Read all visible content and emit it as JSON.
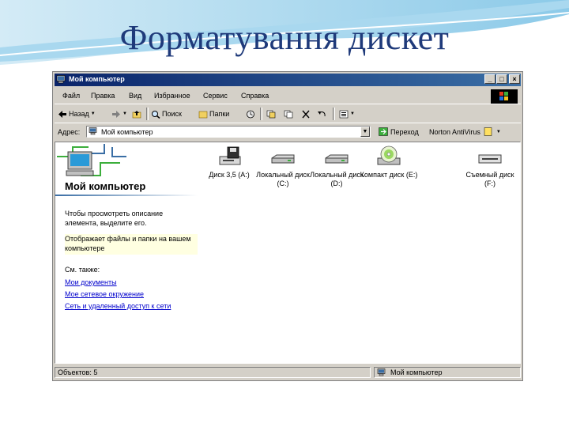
{
  "slide": {
    "title": "Форматування дискет"
  },
  "window": {
    "title": "Мой компьютер",
    "controls": {
      "minimize": "_",
      "maximize": "□",
      "close": "×"
    }
  },
  "menu": [
    "Файл",
    "Правка",
    "Вид",
    "Избранное",
    "Сервис",
    "Справка"
  ],
  "toolbar": {
    "back_label": "Назад",
    "search_label": "Поиск",
    "folders_label": "Папки"
  },
  "address": {
    "label": "Адрес:",
    "value": "Мой компьютер",
    "go_label": "Переход",
    "norton_label": "Norton AntiVirus"
  },
  "left_pane": {
    "heading": "Мой компьютер",
    "description": "Чтобы просмотреть описание элемента, выделите его.",
    "info": "Отображает файлы и папки на вашем компьютере",
    "see_also": "См. также:",
    "links": [
      "Мои документы",
      "Мое сетевое окружение",
      "Сеть и удаленный доступ к сети"
    ]
  },
  "drives": [
    {
      "label": "Диск 3,5 (A:)",
      "icon": "floppy-drive-icon"
    },
    {
      "label": "Локальный диск (C:)",
      "icon": "hard-drive-icon"
    },
    {
      "label": "Локальный диск (D:)",
      "icon": "hard-drive-icon"
    },
    {
      "label": "Компакт диск (E:)",
      "icon": "cd-drive-icon"
    },
    {
      "label": "Съемный диск (F:)",
      "icon": "removable-drive-icon"
    }
  ],
  "status": {
    "objects": "Объектов: 5",
    "location": "Мой компьютер"
  },
  "colors": {
    "title_text": "#1f3a7a",
    "titlebar_start": "#0a246a",
    "titlebar_end": "#3a6ea5",
    "link": "#0000cc",
    "window_face": "#d4d0c8"
  }
}
